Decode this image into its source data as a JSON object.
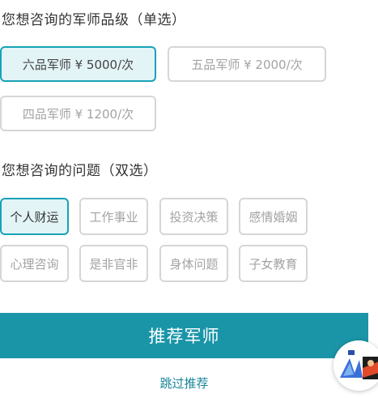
{
  "tier_section": {
    "title": "您想咨询的军师品级（单选）",
    "options": [
      {
        "label": "六品军师 ¥ 5000/次",
        "selected": true
      },
      {
        "label": "五品军师 ¥ 2000/次",
        "selected": false
      },
      {
        "label": "四品军师 ¥ 1200/次",
        "selected": false
      }
    ]
  },
  "question_section": {
    "title": "您想咨询的问题（双选）",
    "options": [
      {
        "label": "个人财运",
        "selected": true
      },
      {
        "label": "工作事业",
        "selected": false
      },
      {
        "label": "投资决策",
        "selected": false
      },
      {
        "label": "感情婚姻",
        "selected": false
      },
      {
        "label": "心理咨询",
        "selected": false
      },
      {
        "label": "是非官非",
        "selected": false
      },
      {
        "label": "身体问题",
        "selected": false
      },
      {
        "label": "子女教育",
        "selected": false
      }
    ]
  },
  "actions": {
    "recommend_label": "推荐军师",
    "skip_label": "跳过推荐"
  },
  "colors": {
    "accent": "#17a2b8",
    "cta_background": "#1a95a8",
    "selected_background": "#e3f4f7"
  },
  "floating_badge": {
    "icon": "avatar-logo-icon"
  }
}
